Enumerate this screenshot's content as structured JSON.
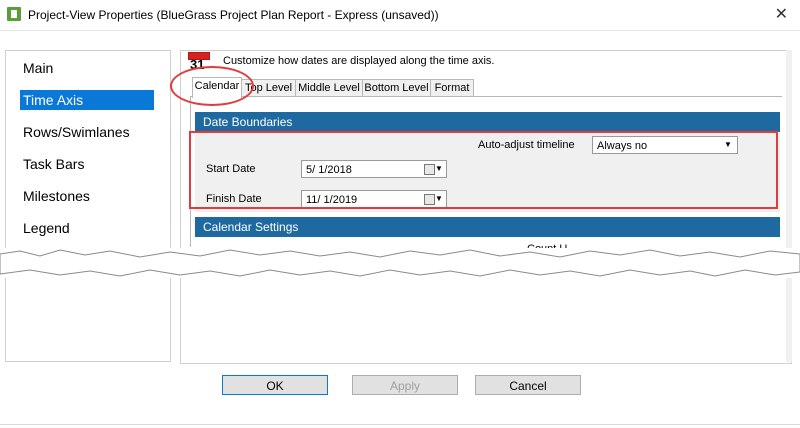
{
  "window": {
    "title": "Project-View Properties (BlueGrass Project Plan Report - Express (unsaved))",
    "close_glyph": "✕"
  },
  "nav": {
    "items": [
      {
        "label": "Main"
      },
      {
        "label": "Time Axis",
        "selected": true
      },
      {
        "label": "Rows/Swimlanes"
      },
      {
        "label": "Task Bars"
      },
      {
        "label": "Milestones"
      },
      {
        "label": "Legend"
      }
    ]
  },
  "content": {
    "calendar_icon_number": "31",
    "description": "Customize how dates are displayed along the time axis.",
    "tabs": [
      "Calendar",
      "Top Level",
      "Middle Level",
      "Bottom Level",
      "Format"
    ],
    "active_tab": "Calendar"
  },
  "date_boundaries": {
    "header": "Date Boundaries",
    "auto_adjust_label": "Auto-adjust timeline",
    "auto_adjust_value": "Always no",
    "start_label": "Start Date",
    "start_value": "5/  1/2018",
    "finish_label": "Finish Date",
    "finish_value": "11/  1/2019"
  },
  "calendar_settings": {
    "header": "Calendar Settings",
    "partial_label": "Count U"
  },
  "buttons": {
    "ok": "OK",
    "apply": "Apply",
    "cancel": "Cancel"
  },
  "colors": {
    "accent": "#0a78d7",
    "section_header": "#1e6aa0",
    "annotation_red": "#e23b3b"
  }
}
